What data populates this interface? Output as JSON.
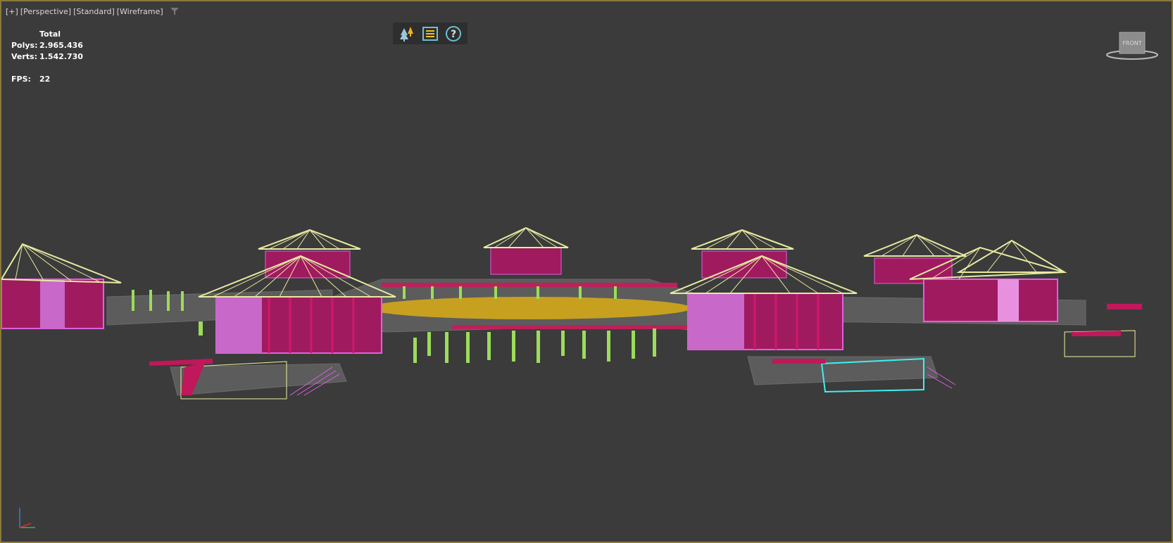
{
  "viewport": {
    "label_plus": "[+]",
    "label_view": "[Perspective]",
    "label_shading": "[Standard]",
    "label_mode": "[Wireframe]"
  },
  "stats": {
    "header": "Total",
    "polys_label": "Polys:",
    "polys_value": "2.965.436",
    "verts_label": "Verts:",
    "verts_value": "1.542.730",
    "fps_label": "FPS:",
    "fps_value": "22"
  },
  "toolbar": {
    "icons": [
      "scene-explorer-icon",
      "menu-list-icon",
      "help-icon"
    ]
  },
  "viewcube": {
    "face_label": "FRONT"
  },
  "colors": {
    "viewport_bg": "#3b3b3b",
    "viewport_border": "#8a7a3a",
    "roof_wire": "#e8eba0",
    "wall_wire": "#d0186a",
    "window_wire": "#e060e0",
    "pillar": "#9bdc5a",
    "deck": "#c8a020",
    "cyan": "#40f0f0"
  }
}
